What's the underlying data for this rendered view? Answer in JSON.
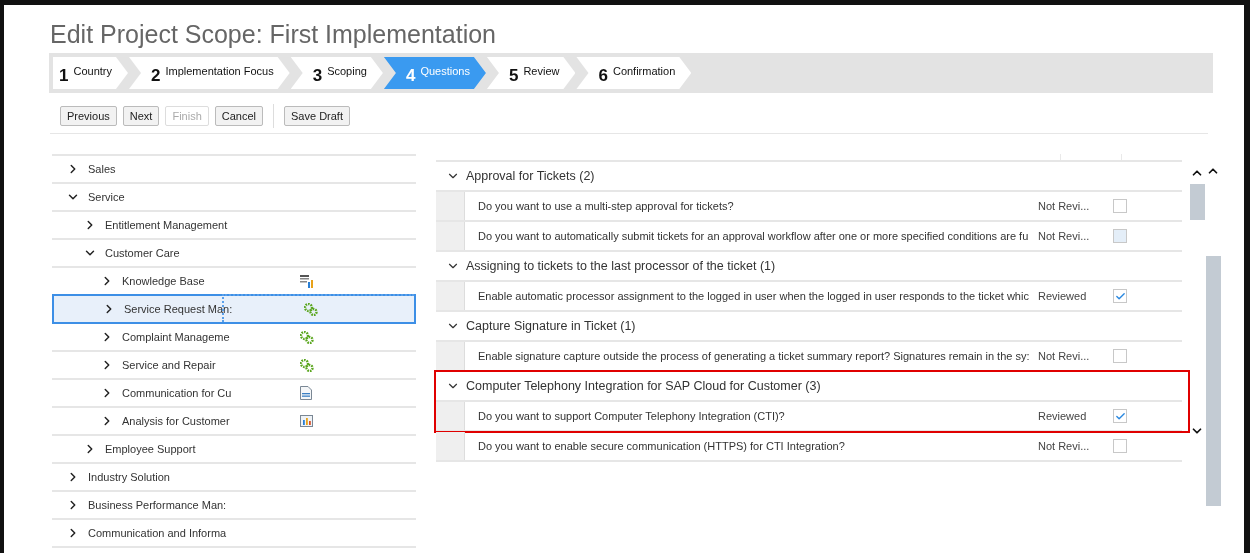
{
  "title": "Edit Project Scope: First Implementation",
  "steps": [
    {
      "number": "1",
      "label": "Country",
      "selected": false
    },
    {
      "number": "2",
      "label": "Implementation Focus",
      "selected": false
    },
    {
      "number": "3",
      "label": "Scoping",
      "selected": false
    },
    {
      "number": "4",
      "label": "Questions",
      "selected": true
    },
    {
      "number": "5",
      "label": "Review",
      "selected": false
    },
    {
      "number": "6",
      "label": "Confirmation",
      "selected": false
    }
  ],
  "buttons": [
    {
      "label": "Previous",
      "disabled": false
    },
    {
      "label": "Next",
      "disabled": false
    },
    {
      "label": "Finish",
      "disabled": true
    },
    {
      "label": "Cancel",
      "disabled": false
    },
    {
      "label": "Save Draft",
      "disabled": false
    }
  ],
  "tree": [
    {
      "label": "Sales",
      "expanded": false,
      "selected": false
    },
    {
      "label": "Service",
      "expanded": true,
      "selected": false,
      "children": [
        {
          "label": "Entitlement Management",
          "expanded": false,
          "selected": false
        },
        {
          "label": "Customer Care",
          "expanded": true,
          "selected": false,
          "children": [
            {
              "label": "Knowledge Base",
              "expanded": false,
              "selected": false,
              "kind": "report"
            },
            {
              "label": "Service Request Man:",
              "expanded": false,
              "selected": true,
              "kind": "process"
            },
            {
              "label": "Complaint Manageme",
              "expanded": false,
              "selected": false,
              "kind": "process"
            },
            {
              "label": "Service and Repair",
              "expanded": false,
              "selected": false,
              "kind": "process"
            },
            {
              "label": "Communication for Cu",
              "expanded": false,
              "selected": false,
              "kind": "form"
            },
            {
              "label": "Analysis for Customer",
              "expanded": false,
              "selected": false,
              "kind": "chart"
            }
          ]
        },
        {
          "label": "Employee Support",
          "expanded": false,
          "selected": false
        }
      ]
    },
    {
      "label": "Industry Solution",
      "expanded": false,
      "selected": false
    },
    {
      "label": "Business Performance Man:",
      "expanded": false,
      "selected": false
    },
    {
      "label": "Communication and Informa",
      "expanded": false,
      "selected": false
    }
  ],
  "questions": [
    {
      "kind": "group",
      "text": "Approval for Tickets (2)",
      "expanded": true,
      "highlighted": false
    },
    {
      "kind": "question",
      "text": "Do you want to use a multi-step approval for tickets?",
      "status": "Not Revi...",
      "checked": false,
      "disabled": false,
      "highlighted": false
    },
    {
      "kind": "question",
      "text": "Do you want to automatically submit tickets for an approval workflow after one or more specified conditions are fu",
      "status": "Not Revi...",
      "checked": false,
      "disabled": true,
      "highlighted": false
    },
    {
      "kind": "group",
      "text": "Assigning to tickets to the last processor of the ticket (1)",
      "expanded": true,
      "highlighted": false
    },
    {
      "kind": "question",
      "text": "Enable automatic processor assignment to the logged in user when the logged in user responds to the ticket whic",
      "status": "Reviewed",
      "checked": true,
      "disabled": false,
      "highlighted": false
    },
    {
      "kind": "group",
      "text": "Capture Signature in Ticket (1)",
      "expanded": true,
      "highlighted": false
    },
    {
      "kind": "question",
      "text": "Enable signature capture outside the process of generating a ticket summary report? Signatures remain in the sy:",
      "status": "Not Revi...",
      "checked": false,
      "disabled": false,
      "highlighted": false
    },
    {
      "kind": "group",
      "text": "Computer Telephony Integration for SAP Cloud for Customer (3)",
      "expanded": true,
      "highlighted": true
    },
    {
      "kind": "question",
      "text": "Do you want to support Computer Telephony Integration (CTI)?",
      "status": "Reviewed",
      "checked": true,
      "disabled": false,
      "highlighted": true
    },
    {
      "kind": "question",
      "text": "Do you want to enable secure communication (HTTPS) for CTI Integration?",
      "status": "Not Revi...",
      "checked": false,
      "disabled": false,
      "highlighted": false
    }
  ]
}
